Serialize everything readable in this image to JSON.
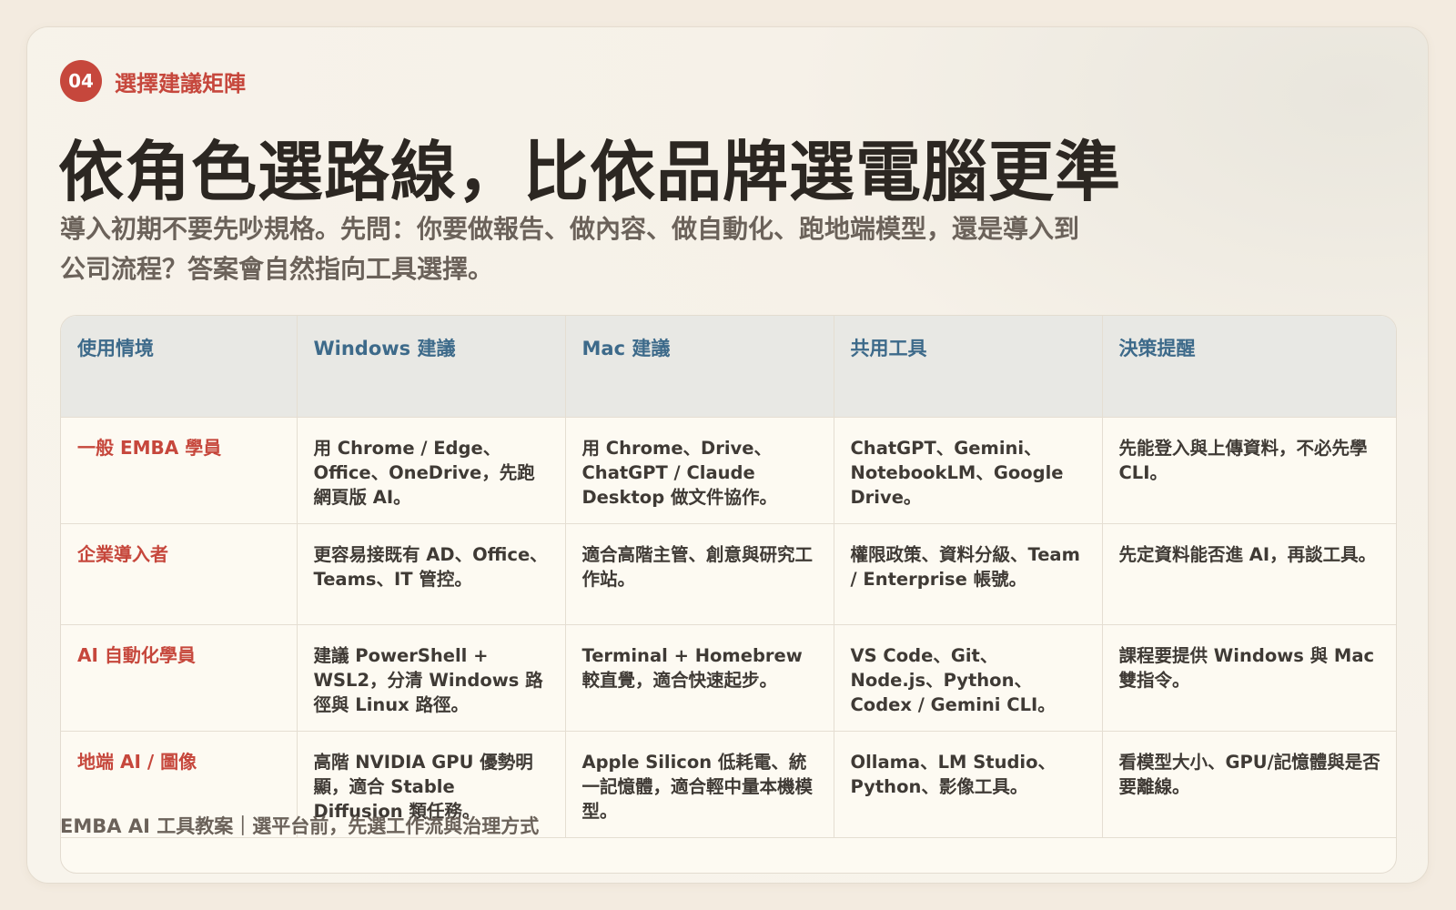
{
  "eyebrow": {
    "number": "04",
    "label": "選擇建議矩陣"
  },
  "headline": "依角色選路線，比依品牌選電腦更準",
  "lead": "導入初期不要先吵規格。先問：你要做報告、做內容、做自動化、跑地端模型，還是導入到公司流程？答案會自然指向工具選擇。",
  "table": {
    "headers": [
      "使用情境",
      "Windows 建議",
      "Mac 建議",
      "共用工具",
      "決策提醒"
    ],
    "rows": [
      [
        "一般 EMBA 學員",
        "用 Chrome / Edge、Office、OneDrive，先跑網頁版 AI。",
        "用 Chrome、Drive、ChatGPT / Claude Desktop 做文件協作。",
        "ChatGPT、Gemini、NotebookLM、Google Drive。",
        "先能登入與上傳資料，不必先學 CLI。"
      ],
      [
        "企業導入者",
        "更容易接既有 AD、Office、Teams、IT 管控。",
        "適合高階主管、創意與研究工作站。",
        "權限政策、資料分級、Team / Enterprise 帳號。",
        "先定資料能否進 AI，再談工具。"
      ],
      [
        "AI 自動化學員",
        "建議 PowerShell + WSL2，分清 Windows 路徑與 Linux 路徑。",
        "Terminal + Homebrew 較直覺，適合快速起步。",
        "VS Code、Git、Node.js、Python、Codex / Gemini CLI。",
        "課程要提供 Windows 與 Mac 雙指令。"
      ],
      [
        "地端 AI / 圖像",
        "高階 NVIDIA GPU 優勢明顯，適合 Stable Diffusion 類任務。",
        "Apple Silicon 低耗電、統一記憶體，適合輕中量本機模型。",
        "Ollama、LM Studio、Python、影像工具。",
        "看模型大小、GPU/記憶體與是否要離線。"
      ]
    ]
  },
  "footer": "EMBA AI 工具教案｜選平台前，先選工作流與治理方式"
}
